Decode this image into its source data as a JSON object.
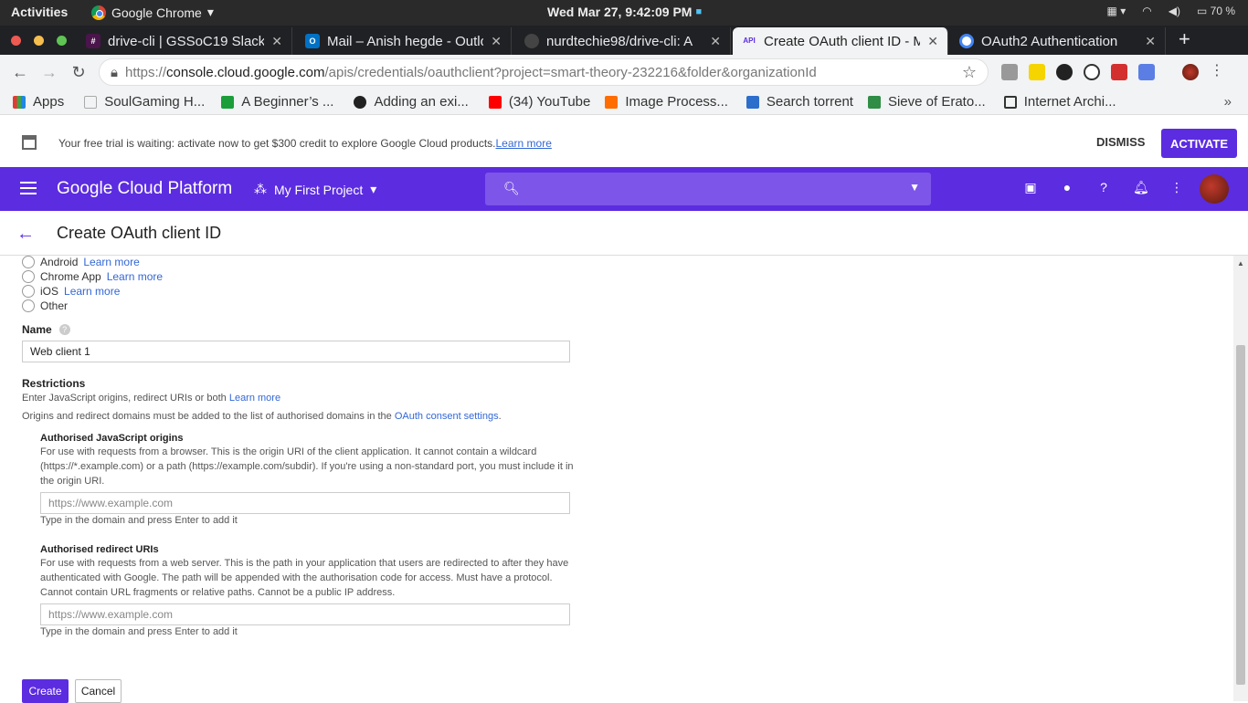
{
  "system": {
    "activities": "Activities",
    "app_name": "Google Chrome",
    "clock": "Wed Mar 27,  9:42:09 PM",
    "battery": "70 %"
  },
  "tabs": [
    {
      "label": "drive-cli | GSSoC19 Slack",
      "favicon_color": "#4a154b"
    },
    {
      "label": "Mail – Anish hegde - Outlo",
      "favicon_color": "#0072c6"
    },
    {
      "label": "nurdtechie98/drive-cli: A",
      "favicon_color": "#222222"
    },
    {
      "label": "Create OAuth client ID - M",
      "favicon_color": "#ffffff",
      "active": true
    },
    {
      "label": "OAuth2 Authentication",
      "favicon_color": "#4285f4"
    }
  ],
  "omnibox": {
    "protocol": "https://",
    "host": "console.cloud.google.com",
    "path": "/apis/credentials/oauthclient?project=smart-theory-232216&folder&organizationId"
  },
  "bookmarks": [
    {
      "label": "Apps",
      "color": "#e53935"
    },
    {
      "label": "SoulGaming H...",
      "color": "#cccccc"
    },
    {
      "label": "A Beginner’s ...",
      "color": "#1b9e3a"
    },
    {
      "label": "Adding an exi...",
      "color": "#222222"
    },
    {
      "label": "(34) YouTube",
      "color": "#ff0000"
    },
    {
      "label": "Image Process...",
      "color": "#ff6d00"
    },
    {
      "label": "Search torrent",
      "color": "#2c6ecb"
    },
    {
      "label": "Sieve of Erato...",
      "color": "#2f8d46"
    },
    {
      "label": "Internet Archi...",
      "color": "#333333"
    }
  ],
  "trial": {
    "message": "Your free trial is waiting: activate now to get $300 credit to explore Google Cloud products.",
    "learn_more": "Learn more",
    "dismiss": "DISMISS",
    "activate": "ACTIVATE"
  },
  "gcp_header": {
    "title": "Google Cloud Platform",
    "project": "My First Project"
  },
  "page": {
    "title": "Create OAuth client ID"
  },
  "app_types": [
    {
      "label": "Android",
      "learn_more": "Learn more"
    },
    {
      "label": "Chrome App",
      "learn_more": "Learn more"
    },
    {
      "label": "iOS",
      "learn_more": "Learn more"
    },
    {
      "label": "Other",
      "learn_more": ""
    }
  ],
  "name_field": {
    "label": "Name",
    "value": "Web client 1"
  },
  "restrictions": {
    "heading": "Restrictions",
    "line1": "Enter JavaScript origins, redirect URIs or both",
    "line1_link": "Learn more",
    "line2": "Origins and redirect domains must be added to the list of authorised domains in the",
    "line2_link": "OAuth consent settings",
    "line2_end": "."
  },
  "js_origins": {
    "label": "Authorised JavaScript origins",
    "help": "For use with requests from a browser. This is the origin URI of the client application. It cannot contain a wildcard (https://*.example.com) or a path (https://example.com/subdir). If you're using a non-standard port, you must include it in the origin URI.",
    "placeholder": "https://www.example.com",
    "hint": "Type in the domain and press Enter to add it"
  },
  "redirect_uris": {
    "label": "Authorised redirect URIs",
    "help": "For use with requests from a web server. This is the path in your application that users are redirected to after they have authenticated with Google. The path will be appended with the authorisation code for access. Must have a protocol. Cannot contain URL fragments or relative paths. Cannot be a public IP address.",
    "placeholder": "https://www.example.com",
    "hint": "Type in the domain and press Enter to add it"
  },
  "buttons": {
    "create": "Create",
    "cancel": "Cancel"
  }
}
